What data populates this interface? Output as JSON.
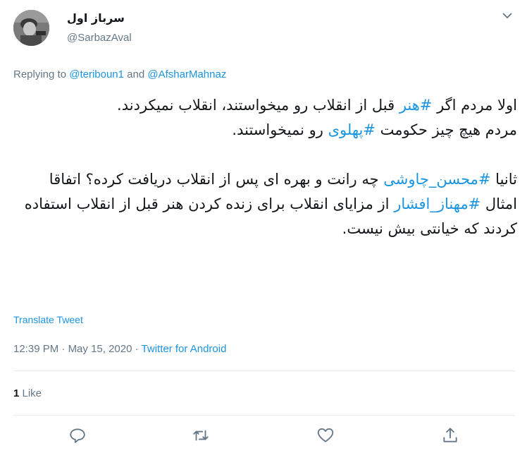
{
  "author": {
    "display_name": "سرباز اول",
    "handle": "@SarbazAval"
  },
  "reply": {
    "prefix": "Replying to ",
    "mention1": "@teriboun1",
    "joiner": " and ",
    "mention2": "@AfsharMahnaz"
  },
  "tweet": {
    "l1a": "اولا مردم اگر ",
    "tag1": "#هنر",
    "l1b": " قبل از انقلاب رو میخواستند، انقلاب نمیکردند.",
    "l2a": "مردم هیچ چیز حکومت ",
    "tag2": "#پهلوی",
    "l2b": " رو نمیخواستند.",
    "l3a": "ثانیا ",
    "tag3": "#محسن_چاوشی",
    "l3b": " چه رانت و بهره ای پس از انقلاب دریافت کرده؟ اتفاقا امثال ",
    "tag4": "#مهناز_افشار",
    "l3c": " از مزایای انقلاب برای زنده کردن هنر قبل از انقلاب استفاده کردند که خیانتی بیش نیست."
  },
  "translate_label": "Translate Tweet",
  "meta": {
    "time": "12:39 PM",
    "sep1": " · ",
    "date": "May 15, 2020",
    "sep2": " · ",
    "source": "Twitter for Android"
  },
  "stats": {
    "likes_count": "1",
    "likes_label": " Like"
  },
  "icons": {
    "more": "chevron-down-icon",
    "reply": "reply-icon",
    "retweet": "retweet-icon",
    "like": "heart-icon",
    "share": "share-icon"
  },
  "colors": {
    "accent": "#1b95e0",
    "muted": "#657786",
    "text": "#14171a"
  }
}
